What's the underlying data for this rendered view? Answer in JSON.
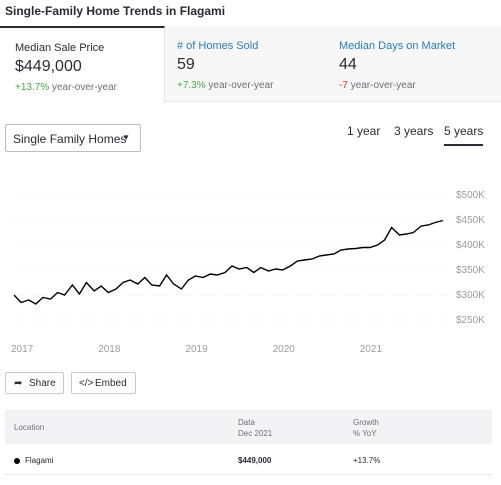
{
  "title": "Single-Family Home Trends in Flagami",
  "stats": [
    {
      "label": "Median Sale Price",
      "value": "$449,000",
      "change": "+13.7%",
      "change_suffix": "year-over-year"
    },
    {
      "label": "# of Homes Sold",
      "value": "59",
      "change": "+7.3%",
      "change_suffix": "year-over-year"
    },
    {
      "label": "Median Days on Market",
      "value": "44",
      "change": "-7",
      "change_suffix": "year-over-year"
    }
  ],
  "filter": {
    "selected": "Single Family Homes",
    "caret_icon": "chevron-down-icon"
  },
  "ranges": [
    "1 year",
    "3 years",
    "5 years"
  ],
  "active_range": "5 years",
  "buttons": {
    "share": "Share",
    "embed": "Embed"
  },
  "table": {
    "col_location": "Location",
    "col_data": "Data",
    "col_data_sub": "Dec 2021",
    "col_growth": "Growth",
    "col_growth_sub": "% YoY",
    "row": {
      "location": "Flagami",
      "value": "$449,000",
      "growth": "+13.7%"
    }
  },
  "colors": {
    "accent": "#2c7ab8",
    "positive": "#4ba84e",
    "negative": "#d8412f",
    "line": "#000000"
  },
  "chart_data": {
    "type": "line",
    "title": "",
    "xlabel": "",
    "ylabel": "",
    "x_ticks": [
      "2017",
      "2018",
      "2019",
      "2020",
      "2021"
    ],
    "y_ticks": [
      "$500K",
      "$450K",
      "$400K",
      "$350K",
      "$300K",
      "$250K"
    ],
    "y_tick_values": [
      500000,
      450000,
      400000,
      350000,
      300000,
      250000
    ],
    "ylim": [
      250000,
      500000
    ],
    "xlim": [
      2017,
      2022
    ],
    "grid": true,
    "series": [
      {
        "x": [
          2017.0,
          2017.08,
          2017.17,
          2017.25,
          2017.33,
          2017.42,
          2017.5,
          2017.58,
          2017.67,
          2017.75,
          2017.83,
          2017.92,
          2018.0,
          2018.08,
          2018.17,
          2018.25,
          2018.33,
          2018.42,
          2018.5,
          2018.58,
          2018.67,
          2018.75,
          2018.83,
          2018.92,
          2019.0,
          2019.08,
          2019.17,
          2019.25,
          2019.33,
          2019.42,
          2019.5,
          2019.58,
          2019.67,
          2019.75,
          2019.83,
          2019.92,
          2020.0,
          2020.08,
          2020.17,
          2020.25,
          2020.33,
          2020.42,
          2020.5,
          2020.58,
          2020.67,
          2020.75,
          2020.83,
          2020.92,
          2021.0,
          2021.08,
          2021.17,
          2021.25,
          2021.33,
          2021.42,
          2021.5,
          2021.58,
          2021.67,
          2021.75,
          2021.83,
          2021.92
        ],
        "values": [
          300000,
          285000,
          290000,
          282000,
          295000,
          292000,
          305000,
          300000,
          320000,
          302000,
          325000,
          308000,
          318000,
          305000,
          312000,
          325000,
          330000,
          322000,
          335000,
          320000,
          318000,
          340000,
          322000,
          312000,
          330000,
          338000,
          335000,
          342000,
          340000,
          345000,
          358000,
          352000,
          355000,
          345000,
          355000,
          348000,
          352000,
          350000,
          358000,
          368000,
          370000,
          372000,
          378000,
          380000,
          382000,
          390000,
          392000,
          393000,
          395000,
          395000,
          400000,
          410000,
          435000,
          420000,
          422000,
          425000,
          438000,
          440000,
          445000,
          449000
        ]
      }
    ]
  }
}
